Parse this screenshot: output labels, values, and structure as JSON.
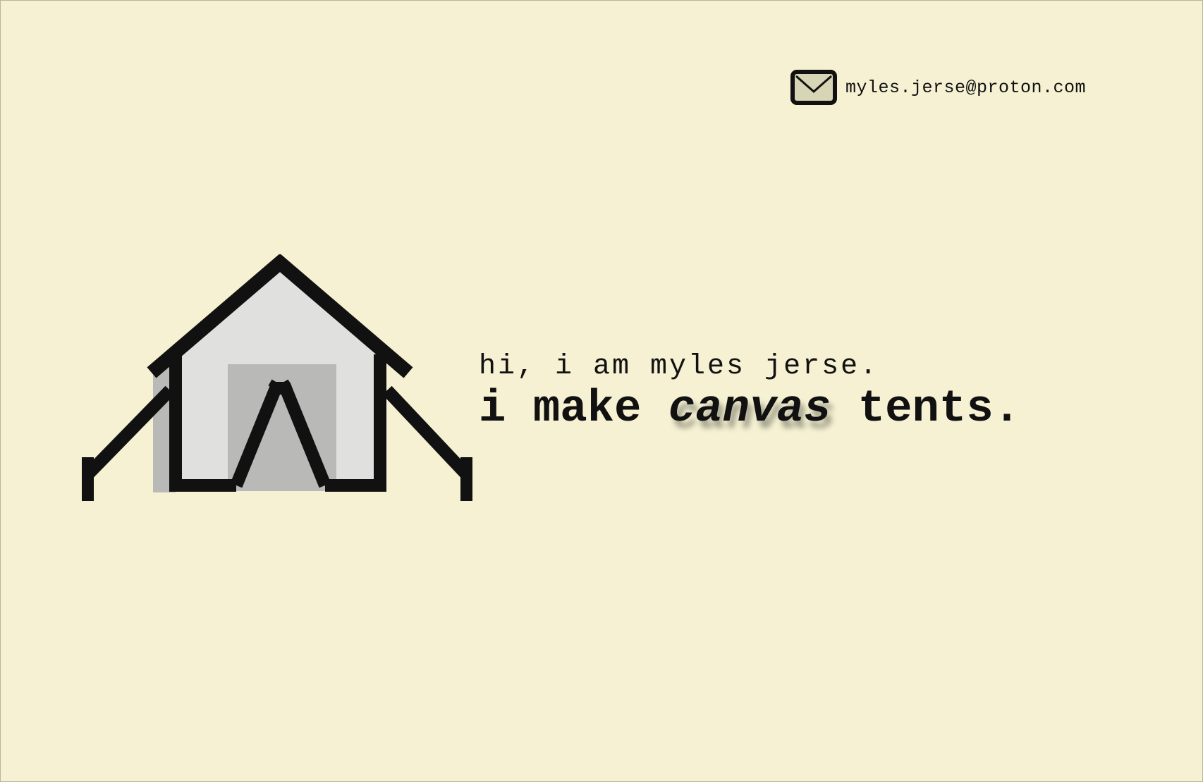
{
  "contact": {
    "email": "myles.jerse@proton.com",
    "icon": "mail-icon"
  },
  "logo": {
    "icon": "tent-logo-icon"
  },
  "hero": {
    "greeting": "hi, i am myles jerse.",
    "tagline_before": "i make",
    "tagline_accent": "canvas",
    "tagline_after": "tents."
  },
  "colors": {
    "background": "#f5f1d2",
    "ink": "#111111",
    "tent_light": "#e0e0df",
    "tent_mid": "#b9b9b8",
    "mail_fill": "#d8d4b6"
  }
}
